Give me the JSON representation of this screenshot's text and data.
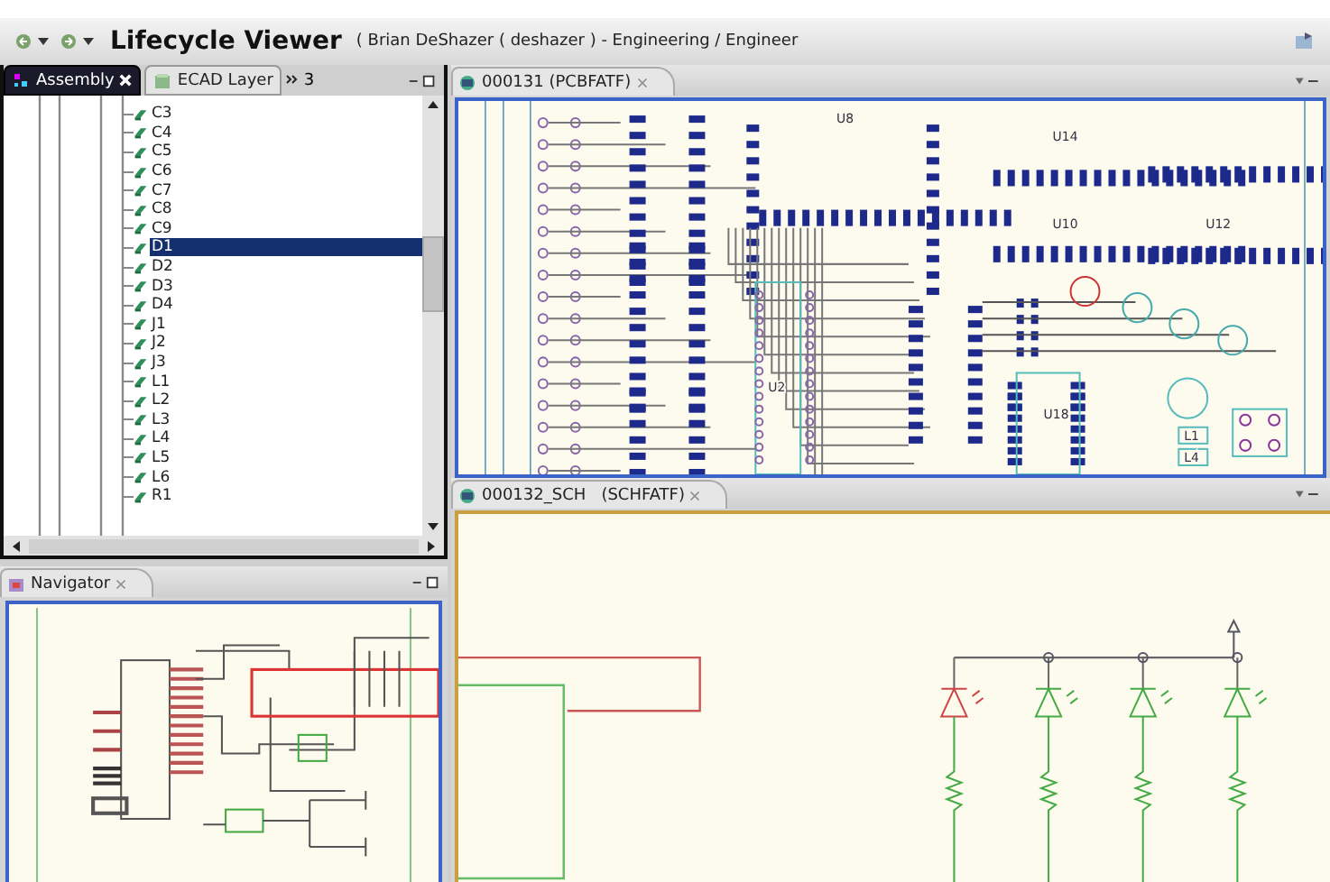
{
  "window": {
    "title": "Lifecycle Viewer",
    "subtitle": "( Brian DeShazer ( deshazer ) - Engineering / Engineer"
  },
  "left_tabs": [
    {
      "label": "Assembly",
      "selected": true
    },
    {
      "label": "ECAD Layer",
      "selected": false
    }
  ],
  "left_overflow": "3",
  "tree": {
    "items": [
      {
        "label": "C3",
        "selected": false
      },
      {
        "label": "C4",
        "selected": false
      },
      {
        "label": "C5",
        "selected": false
      },
      {
        "label": "C6",
        "selected": false
      },
      {
        "label": "C7",
        "selected": false
      },
      {
        "label": "C8",
        "selected": false
      },
      {
        "label": "C9",
        "selected": false
      },
      {
        "label": "D1",
        "selected": true
      },
      {
        "label": "D2",
        "selected": false
      },
      {
        "label": "D3",
        "selected": false
      },
      {
        "label": "D4",
        "selected": false
      },
      {
        "label": "J1",
        "selected": false
      },
      {
        "label": "J2",
        "selected": false
      },
      {
        "label": "J3",
        "selected": false
      },
      {
        "label": "L1",
        "selected": false
      },
      {
        "label": "L2",
        "selected": false
      },
      {
        "label": "L3",
        "selected": false
      },
      {
        "label": "L4",
        "selected": false
      },
      {
        "label": "L5",
        "selected": false
      },
      {
        "label": "L6",
        "selected": false
      },
      {
        "label": "R1",
        "selected": false
      }
    ]
  },
  "navigator": {
    "title": "Navigator"
  },
  "pcb_editor": {
    "tab": "000131 (PCBFATF)",
    "labels": [
      "U8",
      "U14",
      "U10",
      "U12",
      "U2",
      "U18",
      "L1",
      "L4"
    ]
  },
  "schematic_editor": {
    "tab": "000132_SCH   (SCHFATF)"
  }
}
